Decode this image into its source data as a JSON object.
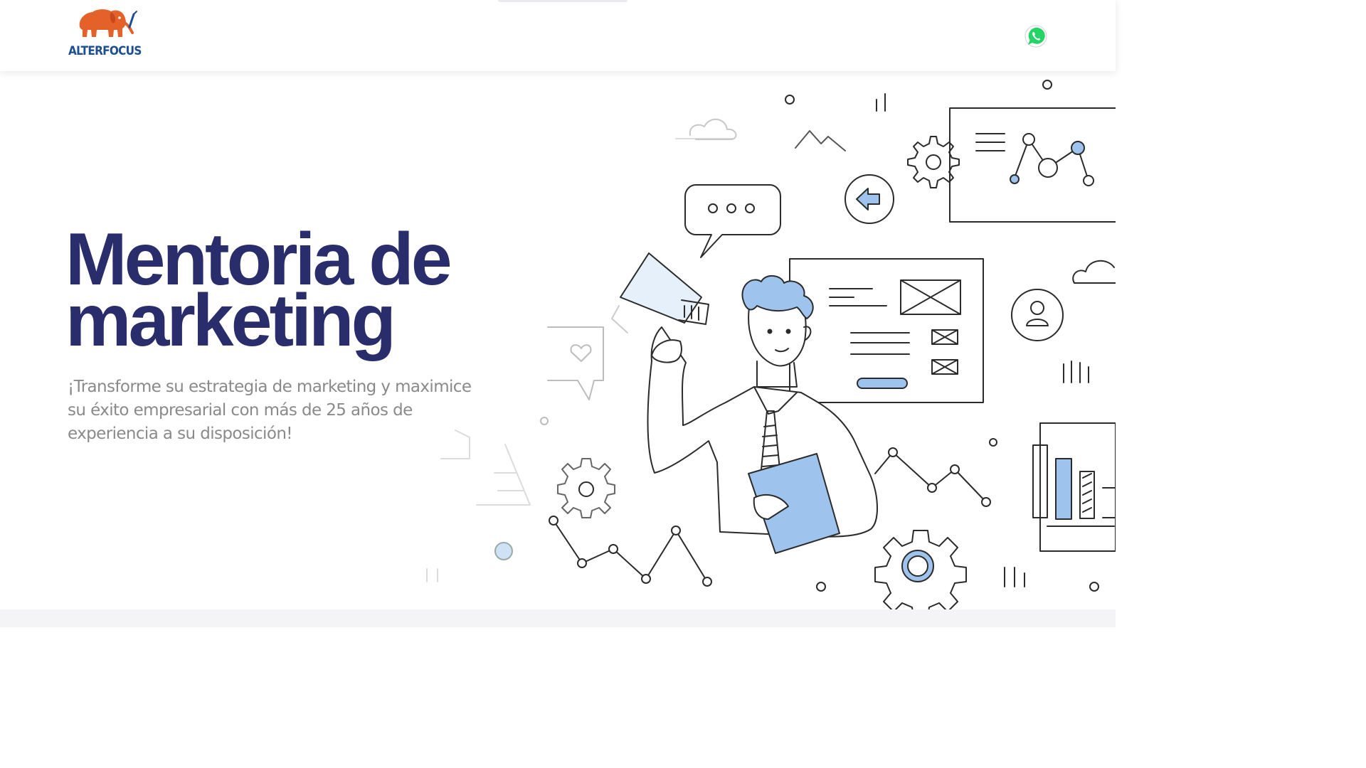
{
  "header": {
    "logo_text": "ALTERFOCUS",
    "logo_icon": "elephant-icon",
    "whatsapp_icon": "whatsapp-icon"
  },
  "hero": {
    "title_line1": "Mentoria de",
    "title_line2": "marketing",
    "subtitle": "¡Transforme su estrategia de marketing y maximice su éxito empresarial con más de 25 años de experiencia a su disposición!",
    "illustration": "marketing-mentor-illustration"
  },
  "colors": {
    "brand_orange": "#e4622a",
    "brand_blue": "#1d4f91",
    "title_navy": "#2a2d6c",
    "subtitle_gray": "#8a8a8a",
    "accent_blue": "#9ec4ee",
    "whatsapp_green": "#25d366"
  }
}
